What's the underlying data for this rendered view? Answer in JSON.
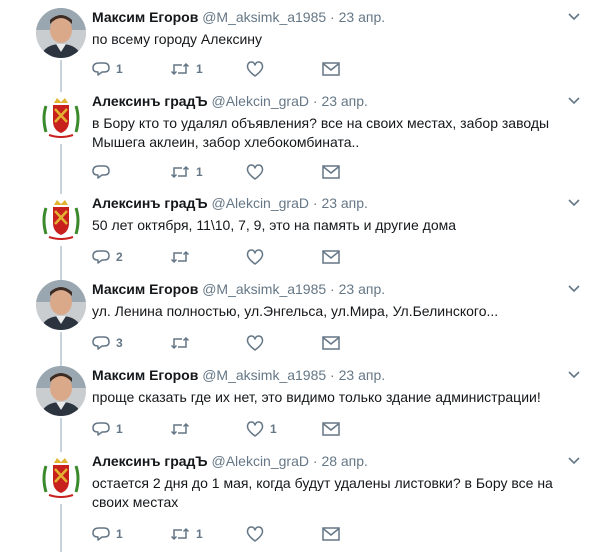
{
  "tweets": [
    {
      "name": "Максим Егоров",
      "handle": "@M_aksimk_a1985",
      "separator": "·",
      "date": "23 апр.",
      "text": "по всему городу Алексину",
      "replies": "1",
      "retweets": "1",
      "likes": "",
      "avatar": "person-photo"
    },
    {
      "name": "Алексинъ градЪ",
      "handle": "@Alekcin_graD",
      "separator": "·",
      "date": "23 апр.",
      "text": "в Бору кто то удалял объявления? все на своих местах, забор заводы Мышега аклеин, забор хлебокомбината..",
      "replies": "",
      "retweets": "1",
      "likes": "",
      "avatar": "coat-of-arms"
    },
    {
      "name": "Алексинъ градЪ",
      "handle": "@Alekcin_graD",
      "separator": "·",
      "date": "23 апр.",
      "text": "50 лет октября, 11\\10, 7, 9, это на память и другие дома",
      "replies": "2",
      "retweets": "",
      "likes": "",
      "avatar": "coat-of-arms"
    },
    {
      "name": "Максим Егоров",
      "handle": "@M_aksimk_a1985",
      "separator": "·",
      "date": "23 апр.",
      "text": "ул. Ленина полностью, ул.Энгельса, ул.Мира, Ул.Белинского...",
      "replies": "3",
      "retweets": "",
      "likes": "",
      "avatar": "person-photo"
    },
    {
      "name": "Максим Егоров",
      "handle": "@M_aksimk_a1985",
      "separator": "·",
      "date": "23 апр.",
      "text": "проще сказать где их нет,  это видимо только здание администрации!",
      "replies": "1",
      "retweets": "",
      "likes": "1",
      "avatar": "person-photo"
    },
    {
      "name": "Алексинъ градЪ",
      "handle": "@Alekcin_graD",
      "separator": "·",
      "date": "28 апр.",
      "text": "остается 2 дня до 1 мая, когда будут удалены листовки? в Бору все на своих местах",
      "replies": "1",
      "retweets": "1",
      "likes": "",
      "avatar": "coat-of-arms"
    }
  ],
  "colors": {
    "text": "#14171a",
    "secondary": "#657786",
    "connector": "#c7d2dc",
    "coat_green": "#3a8a2c",
    "coat_red": "#c8201d",
    "coat_gold": "#e3b232"
  },
  "icons": [
    "reply-icon",
    "retweet-icon",
    "like-icon",
    "direct-message-icon",
    "chevron-down-icon"
  ]
}
